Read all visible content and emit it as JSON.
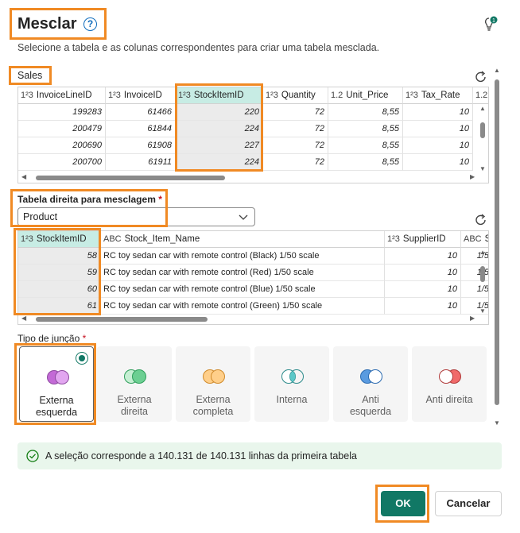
{
  "dialog": {
    "title": "Mesclar",
    "help_icon": "question-circle-icon",
    "help_glyph": "?",
    "lightbulb_icon": "lightbulb-notification-icon",
    "lightbulb_badge": "1",
    "subtitle": "Selecione a tabela e as colunas correspondentes para criar uma tabela mesclada."
  },
  "left_table": {
    "name": "Sales",
    "columns": [
      {
        "type": "1²3",
        "name": "InvoiceLineID"
      },
      {
        "type": "1²3",
        "name": "InvoiceID"
      },
      {
        "type": "1²3",
        "name": "StockItemID"
      },
      {
        "type": "1²3",
        "name": "Quantity"
      },
      {
        "type": "1.2",
        "name": "Unit_Price"
      },
      {
        "type": "1²3",
        "name": "Tax_Rate"
      },
      {
        "type": "1.2",
        "name": ""
      }
    ],
    "rows": [
      [
        "199283",
        "61466",
        "220",
        "72",
        "8,55",
        "10"
      ],
      [
        "200479",
        "61844",
        "224",
        "72",
        "8,55",
        "10"
      ],
      [
        "200690",
        "61908",
        "227",
        "72",
        "8,55",
        "10"
      ],
      [
        "200700",
        "61911",
        "224",
        "72",
        "8,55",
        "10"
      ]
    ]
  },
  "right_table": {
    "label": "Tabela direita para mesclagem",
    "required_mark": "*",
    "selected": "Product",
    "columns": [
      {
        "type": "1²3",
        "name": "StockItemID"
      },
      {
        "type": "ABC",
        "name": "Stock_Item_Name"
      },
      {
        "type": "1²3",
        "name": "SupplierID"
      },
      {
        "type": "ABC",
        "name": "Siz"
      }
    ],
    "rows": [
      [
        "58",
        "RC toy sedan car with remote control (Black) 1/50 scale",
        "10",
        "1/5"
      ],
      [
        "59",
        "RC toy sedan car with remote control (Red) 1/50 scale",
        "10",
        "1/5"
      ],
      [
        "60",
        "RC toy sedan car with remote control (Blue) 1/50 scale",
        "10",
        "1/5"
      ],
      [
        "61",
        "RC toy sedan car with remote control (Green) 1/50 scale",
        "10",
        "1/5"
      ]
    ]
  },
  "join": {
    "label": "Tipo de junção",
    "required_mark": "*",
    "options": [
      {
        "line1": "Externa",
        "line2": "esquerda",
        "selected": true
      },
      {
        "line1": "Externa",
        "line2": "direita",
        "selected": false
      },
      {
        "line1": "Externa",
        "line2": "completa",
        "selected": false
      },
      {
        "line1": "Interna",
        "line2": "",
        "selected": false
      },
      {
        "line1": "Anti",
        "line2": "esquerda",
        "selected": false
      },
      {
        "line1": "Anti direita",
        "line2": "",
        "selected": false
      }
    ]
  },
  "status": {
    "icon": "check-circle-icon",
    "text": "A seleção corresponde a 140.131 de 140.131 linhas da primeira tabela"
  },
  "buttons": {
    "ok": "OK",
    "cancel": "Cancelar"
  },
  "colors": {
    "accent": "#117865",
    "highlight": "#f08a24",
    "selected_header": "#c7ece4",
    "status_bg": "#e9f6ec"
  }
}
